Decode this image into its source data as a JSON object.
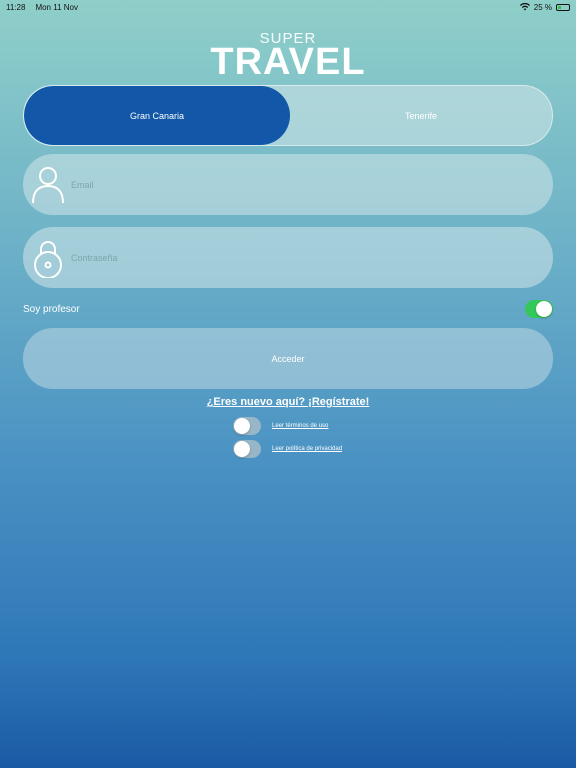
{
  "status_bar": {
    "time": "11:28",
    "date": "Mon 11 Nov",
    "battery": "25 %"
  },
  "logo": {
    "line1": "SUPER",
    "line2": "TRAVEL"
  },
  "segments": [
    {
      "label": "Gran Canaria",
      "active": true
    },
    {
      "label": "Tenerife",
      "active": false
    }
  ],
  "email": {
    "placeholder": "Email",
    "value": ""
  },
  "password": {
    "placeholder": "Contraseña",
    "value": ""
  },
  "teacher_switch": {
    "label": "Soy profesor",
    "on": true
  },
  "access_button": {
    "label": "Acceder"
  },
  "register_link": {
    "label": "¿Eres nuevo aquí? ¡Regístrate!"
  },
  "legal": [
    {
      "label": "Leer términos de uso",
      "on": false
    },
    {
      "label": "Leer política de privacidad",
      "on": false
    }
  ],
  "colors": {
    "active_segment": "#1257a8",
    "toggle_on": "#34c759"
  },
  "icons": [
    "wifi-icon",
    "battery-icon",
    "user-icon",
    "lock-icon"
  ]
}
